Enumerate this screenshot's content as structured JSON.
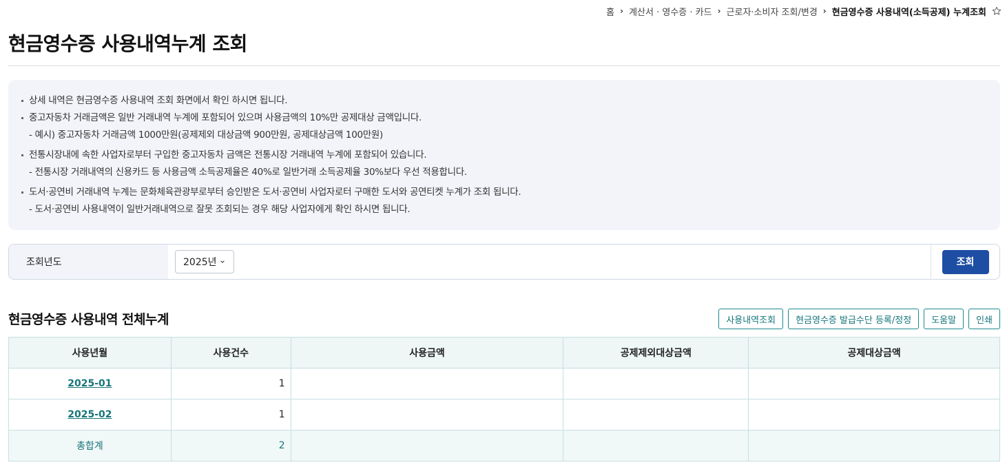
{
  "breadcrumb": {
    "items": [
      "홈",
      "계산서 · 영수증 · 카드",
      "근로자·소비자 조회/변경"
    ],
    "current": "현금영수증 사용내역(소득공제) 누계조회"
  },
  "page_title": "현금영수증 사용내역누계 조회",
  "info": {
    "items": [
      {
        "text": "상세 내역은 현금영수증 사용내역 조회 화면에서 확인 하시면 됩니다.",
        "sub": ""
      },
      {
        "text": "중고자동차 거래금액은 일반 거래내역 누계에 포함되어 있으며 사용금액의 10%만 공제대상 금액입니다.",
        "sub": "- 예시) 중고자동차 거래금액 1000만원(공제제외 대상금액 900만원, 공제대상금액 100만원)"
      },
      {
        "text": "전통시장내에 속한 사업자로부터 구입한 중고자동차 금액은 전통시장 거래내역 누계에 포함되어 있습니다.",
        "sub": "- 전통시장 거래내역의 신용카드 등 사용금액 소득공제율은 40%로 일반거래 소득공제율 30%보다 우선 적용합니다."
      },
      {
        "text": "도서·공연비 거래내역 누계는 문화체육관광부로부터 승인받은 도서·공연비 사업자로터 구매한 도서와 공연티켓 누계가 조회 됩니다.",
        "sub": "- 도서·공연비 사용내역이 일반거래내역으로 잘못 조회되는 경우 해당 사업자에게 확인 하시면 됩니다."
      }
    ]
  },
  "search": {
    "label": "조회년도",
    "year_value": "2025년",
    "button_label": "조회"
  },
  "section": {
    "title": "현금영수증 사용내역 전체누계",
    "buttons": [
      "사용내역조회",
      "현금영수증 발급수단 등록/정정",
      "도움말",
      "인쇄"
    ]
  },
  "table": {
    "headers": [
      "사용년월",
      "사용건수",
      "사용금액",
      "공제제외대상금액",
      "공제대상금액"
    ],
    "rows": [
      {
        "month": "2025-01",
        "count": "1",
        "amount": "",
        "excluded": "",
        "deductible": ""
      },
      {
        "month": "2025-02",
        "count": "1",
        "amount": "",
        "excluded": "",
        "deductible": ""
      }
    ],
    "total": {
      "label": "총합계",
      "count": "2",
      "amount": "",
      "excluded": "",
      "deductible": ""
    }
  },
  "colors": {
    "accent_navy": "#1e4ea3",
    "accent_teal": "#17757a",
    "info_bg": "#f2f4f9"
  }
}
